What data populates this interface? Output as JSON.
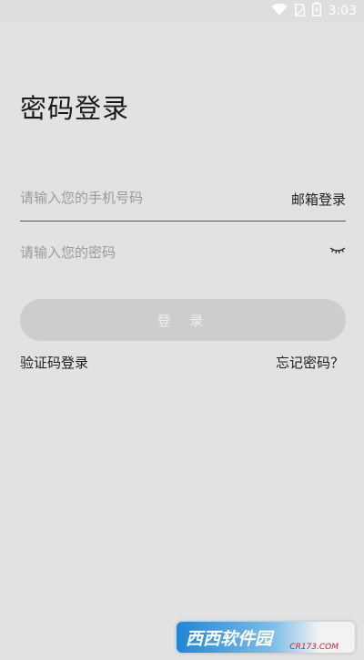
{
  "status_bar": {
    "time": "3:03"
  },
  "title": "密码登录",
  "phone": {
    "placeholder": "请输入您的手机号码",
    "value": ""
  },
  "email_login_label": "邮箱登录",
  "password": {
    "placeholder": "请输入您的密码",
    "value": ""
  },
  "login_button_label": "登 录",
  "sms_login_label": "验证码登录",
  "forgot_password_label": "忘记密码？",
  "watermark": {
    "text": "西西软件园",
    "sub": "CR173.COM"
  },
  "colors": {
    "background": "#e2e2e2",
    "button_disabled": "#cdcdcd",
    "button_text": "#ededed",
    "placeholder": "#9b9b9b"
  },
  "icons": {
    "wifi": "wifi-icon",
    "sim": "sim-icon",
    "battery": "battery-icon",
    "eye": "eye-closed-icon"
  }
}
